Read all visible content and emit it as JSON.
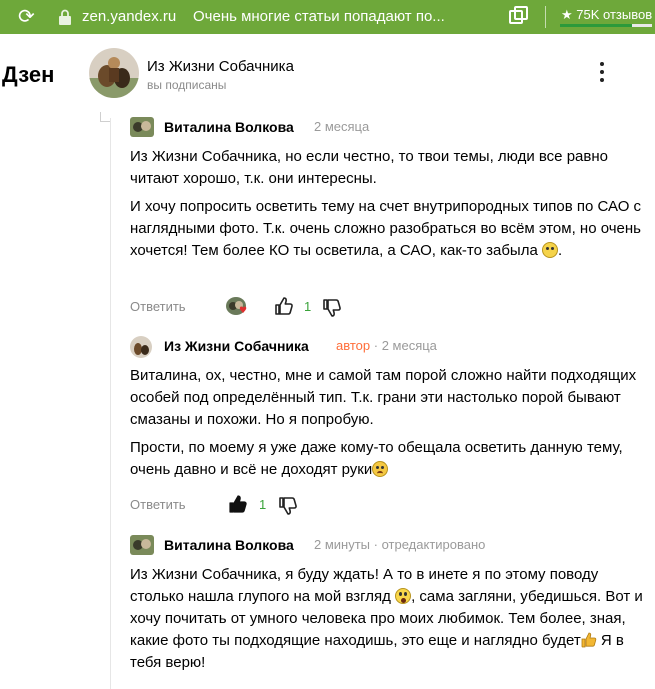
{
  "browser": {
    "url": "zen.yandex.ru",
    "tab_title": "Очень многие статьи попадают по...",
    "reviews_label": "75K отзывов",
    "reviews_star": "★",
    "reload_icon": "refresh-icon",
    "lock_icon": "lock-icon",
    "colors": {
      "bar": "#6ea83a"
    }
  },
  "header": {
    "logo": "Дзен",
    "channel_name": "Из Жизни Собачника",
    "subscription_status": "вы подписаны"
  },
  "comments": [
    {
      "author": "Виталина Волкова",
      "time": "2 месяца",
      "paragraphs": [
        "Из Жизни Собачника, но если честно, то твои темы, люди все равно читают хорошо, т.к. они интересны.",
        "И хочу попросить осветить тему на счет внутрипородных типов по САО с наглядными фото. Т.к. очень сложно разобраться во всём этом, но очень хочется! Тем более КО ты осветила, а САО, как-то забыла "
      ],
      "reply_label": "Ответить",
      "like_count": "1",
      "liked_by_author": true
    },
    {
      "author": "Из Жизни Собачника",
      "badge": "автор",
      "time": "2 месяца",
      "paragraphs": [
        "Виталина, ох, честно, мне и самой там порой сложно найти подходящих особей под определённый тип. Т.к. грани эти настолько порой бывают смазаны и похожи. Но я попробую.",
        "Прости, по моему я уже даже кому-то обещала осветить данную тему, очень давно и всё не доходят руки"
      ],
      "reply_label": "Ответить",
      "like_count": "1",
      "liked_by_me": true
    },
    {
      "author": "Виталина Волкова",
      "time": "2 минуты",
      "edited": "отредактировано",
      "paragraphs": [
        "Из Жизни Собачника, я буду ждать! А то в инете я по этому поводу столько нашла глупого на мой взгляд ",
        ", сама загляни, убедишься. Вот и хочу почитать от умного человека про моих любимок. Тем более, зная, какие фото ты подходящие находишь, это еще и наглядно будет",
        " Я в тебя верю!"
      ]
    }
  ]
}
